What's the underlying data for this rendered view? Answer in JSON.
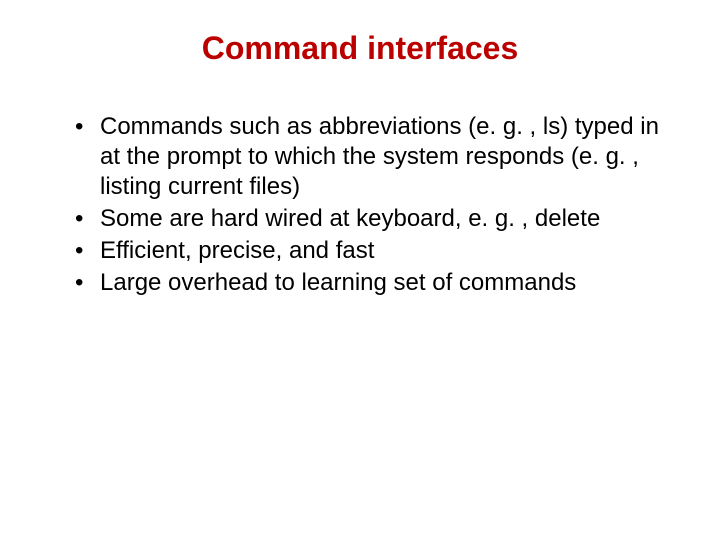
{
  "slide": {
    "title": "Command interfaces",
    "bullets": [
      "Commands such as abbreviations (e. g. , ls) typed in at the prompt to which the system responds (e. g. , listing current files)",
      "Some are hard wired at keyboard, e. g. , delete",
      "Efficient, precise, and fast",
      "Large overhead to learning set of commands"
    ]
  }
}
